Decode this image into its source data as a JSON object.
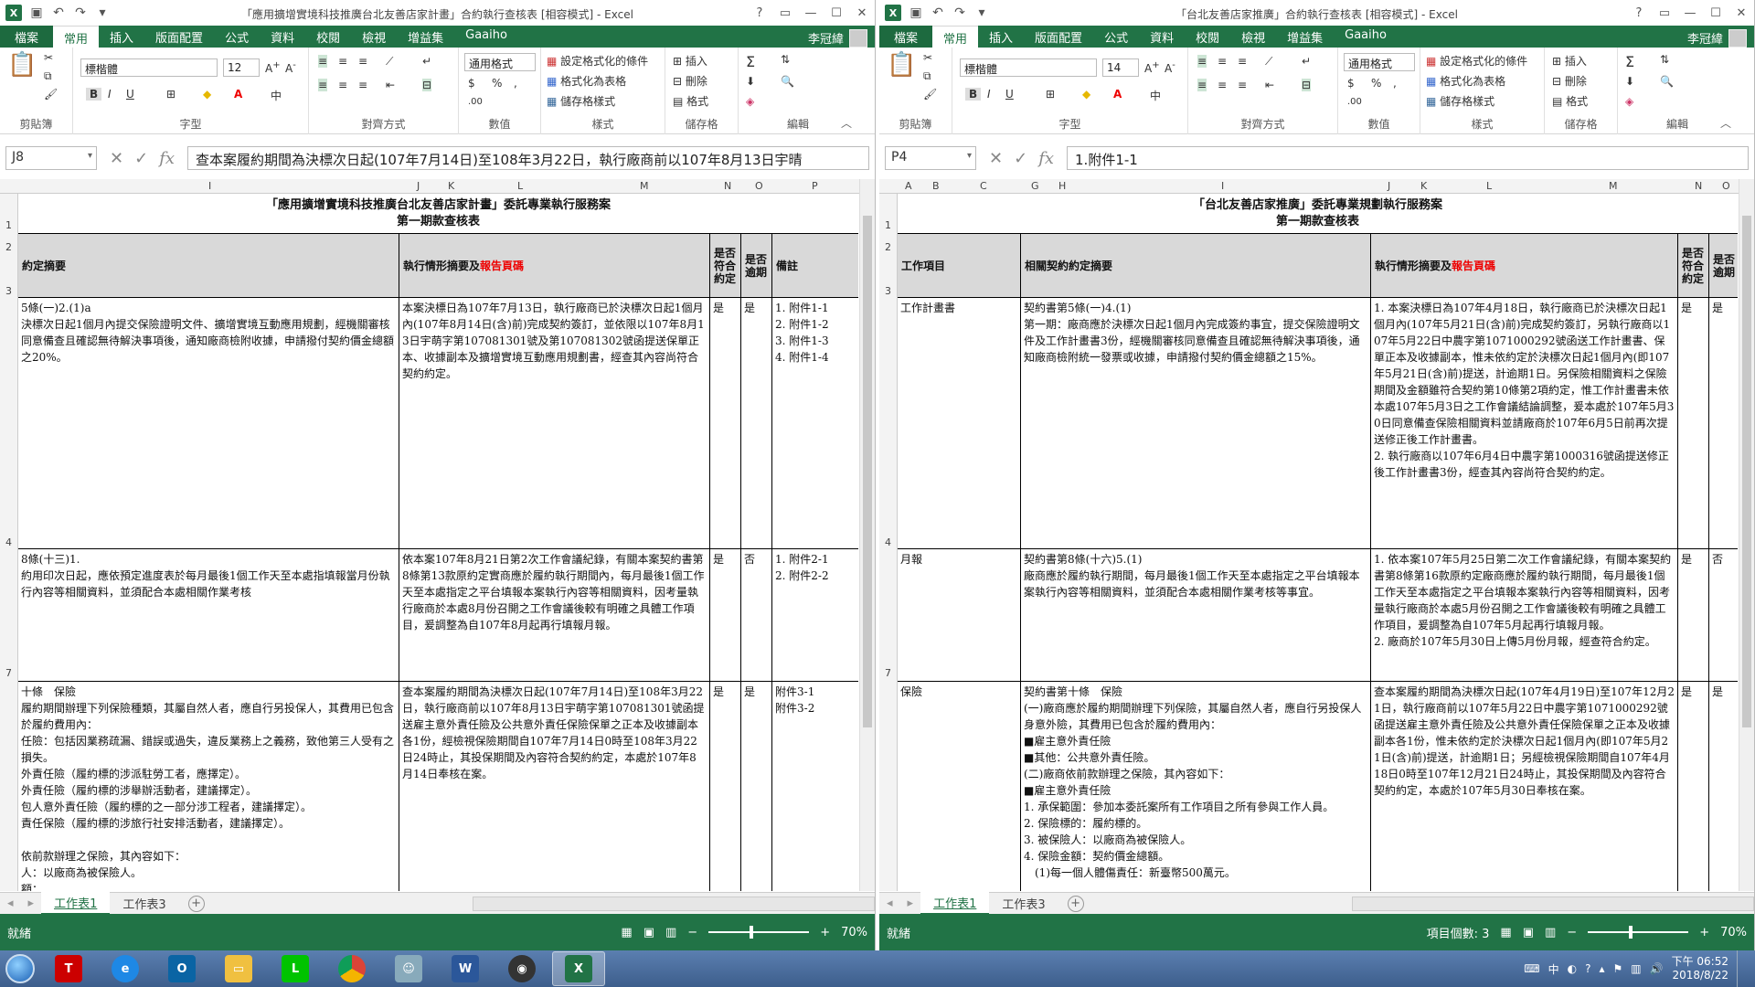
{
  "left": {
    "title": "「應用擴增實境科技推廣台北友善店家計畫」合約執行查核表 [相容模式] - Excel",
    "namebox": "J8",
    "formula": "查本案履約期間為決標次日起(107年7月14日)至108年3月22日，執行廠商前以107年8月13日宇晴",
    "col_letters": [
      "I",
      "J",
      "K",
      "L",
      "M",
      "N",
      "O",
      "P"
    ],
    "row_numbers": [
      "1",
      "2",
      "3",
      "4",
      "7"
    ],
    "sheet_title_1": "「應用擴增實境科技推廣台北友善店家計畫」委託專業執行服務案",
    "sheet_title_2": "第一期款查核表",
    "headers": {
      "c1": "約定摘要",
      "c2a": "執行情形摘要及",
      "c2b": "報告頁碼",
      "c3": "是否符合約定",
      "c4": "是否逾期",
      "c5": "備註"
    },
    "rows": [
      {
        "a": "5條(一)2.(1)a\n決標次日起1個月內提交保險證明文件、擴增實境互動應用規劃，經機關審核同意備查且確認無待解決事項後，通知廠商檢附收據，申請撥付契約價金總額之20%。",
        "b": "本案決標日為107年7月13日，執行廠商已於決標次日起1個月內(107年8月14日(含)前)完成契約簽訂，並依限以107年8月13日宇萌字第107081301號及第107081302號函提送保單正本、收據副本及擴增實境互動應用規劃書，經查其內容尚符合契約約定。",
        "c": "是",
        "d": "是",
        "e": "1. 附件1-1\n2. 附件1-2\n3. 附件1-3\n4. 附件1-4"
      },
      {
        "a": "8條(十三)1.\n約用印次日起，應依預定進度表於每月最後1個工作天至本處指填報當月份執行內容等相關資料，並須配合本處相關作業考核",
        "b": "依本案107年8月21日第2次工作會議紀錄，有關本案契約書第8條第13款原約定實商應於履約執行期間內，每月最後1個工作天至本處指定之平台填報本案執行內容等相關資料，因考量執行廠商於本處8月份召開之工作會議後較有明確之具體工作項目，爰調整為自107年8月起再行填報月報。",
        "c": "是",
        "d": "否",
        "e": "1. 附件2-1\n2. 附件2-2"
      },
      {
        "a": "十條　保險\n履約期間辦理下列保險種類，其屬自然人者，應自行另投保人，其費用已包含於履約費用內：\n任險：包括因業務疏漏、錯誤或過失，違反業務上之義務，致他第三人受有之損失。\n外責任險（履約標的涉派駐勞工者，應擇定）。\n外責任險（履約標的涉舉辦活動者，建議擇定）。\n包人意外責任險（履約標的之一部分涉工程者，建議擇定）。\n責任保險（履約標的涉旅行社安排活動者，建議擇定）。\n\n依前款辦理之保險，其內容如下：\n人：以廠商為被保險人。\n額：",
        "b": "查本案履約期間為決標次日起(107年7月14日)至108年3月22日，執行廠商前以107年8月13日宇萌字第107081301號函提送雇主意外責任險及公共意外責任保險保單之正本及收據副本各1份，經檢視保險期間自107年7月14日0時至108年3月22日24時止，其投保期間及內容符合契約約定，本處於107年8月14日奉核在案。",
        "c": "是",
        "d": "是",
        "e": "附件3-1\n附件3-2"
      }
    ]
  },
  "right": {
    "title": "「台北友善店家推廣」合約執行查核表 [相容模式] - Excel",
    "namebox": "P4",
    "formula": "1.附件1-1",
    "col_letters": [
      "A",
      "B",
      "C",
      "G",
      "H",
      "I",
      "J",
      "K",
      "L",
      "M",
      "N",
      "O"
    ],
    "row_numbers": [
      "1",
      "2",
      "3",
      "4",
      "7"
    ],
    "sheet_title_1": "「台北友善店家推廣」委託專業規劃執行服務案",
    "sheet_title_2": "第一期款查核表",
    "headers": {
      "c1": "工作項目",
      "c2": "相關契約約定摘要",
      "c3a": "執行情形摘要及",
      "c3b": "報告頁碼",
      "c4": "是否符合約定",
      "c5": "是否逾期"
    },
    "rows": [
      {
        "a": "工作計畫書",
        "b": "契約書第5條(一)4.(1)\n第一期：廠商應於決標次日起1個月內完成簽約事宜，提交保險證明文件及工作計畫書3份，經機關審核同意備查且確認無待解決事項後，通知廠商檢附統一發票或收據，申請撥付契約價金總額之15%。",
        "c": "1. 本案決標日為107年4月18日，執行廠商已於決標次日起1個月內(107年5月21日(含)前)完成契約簽訂，另執行廠商以107年5月22日中農字第1071000292號函送工作計畫書、保單正本及收據副本，惟未依約定於決標次日起1個月內(即107年5月21日(含)前)提送，計逾期1日。另保險相關資料之保險期間及金額雖符合契約第10條第2項約定，惟工作計畫書未依本處107年5月3日之工作會議結論調整，爰本處於107年5月30日同意備查保險相關資料並請廠商於107年6月5日前再次提送修正後工作計畫書。\n2. 執行廠商以107年6月4日中農字第1000316號函提送修正後工作計畫書3份，經查其內容尚符合契約約定。",
        "d": "是",
        "e": "是"
      },
      {
        "a": "月報",
        "b": "契約書第8條(十六)5.(1)\n廠商應於履約執行期間，每月最後1個工作天至本處指定之平台填報本案執行內容等相關資料，並須配合本處相關作業考核等事宜。",
        "c": "1. 依本案107年5月25日第二次工作會議紀錄，有關本案契約書第8條第16款原約定廠商應於履約執行期間，每月最後1個工作天至本處指定之平台填報本案執行內容等相關資料，因考量執行廠商於本處5月份召開之工作會議後較有明確之具體工作項目，爰調整為自107年5月起再行填報月報。\n2. 廠商於107年5月30日上傳5月份月報，經查符合約定。",
        "d": "是",
        "e": "否"
      },
      {
        "a": "保險",
        "b": "契約書第十條　保險\n(一)廠商應於履約期間辦理下列保險，其屬自然人者，應自行另投保人身意外險，其費用已包含於履約費用內：\n■雇主意外責任險\n■其他：公共意外責任險。\n(二)廠商依前款辦理之保險，其內容如下：\n■雇主意外責任險\n1. 承保範圍：參加本委託案所有工作項目之所有參與工作人員。\n2. 保險標的：履約標的。\n3. 被保險人：以廠商為被保險人。\n4. 保險金額：契約價金總額。\n　(1)每一個人體傷責任：新臺幣500萬元。",
        "c": "查本案履約期間為決標次日起(107年4月19日)至107年12月21日，執行廠商前以107年5月22日中農字第1071000292號函提送雇主意外責任險及公共意外責任保險保單之正本及收據副本各1份，惟未依約定於決標次日起1個月內(即107年5月21日(含)前)提送，計逾期1日；另經檢視保險期間自107年4月18日0時至107年12月21日24時止，其投保期間及內容符合契約約定，本處於107年5月30日奉核在案。",
        "d": "是",
        "e": "是"
      }
    ]
  },
  "ribbon": {
    "tabs": [
      "檔案",
      "常用",
      "插入",
      "版面配置",
      "公式",
      "資料",
      "校閱",
      "檢視",
      "增益集",
      "Gaaiho"
    ],
    "user": "李冠緯",
    "font_name": "標楷體",
    "font_size_left": "12",
    "font_size_right": "14",
    "number_format": "通用格式",
    "groups": [
      "剪貼簿",
      "字型",
      "對齊方式",
      "數值",
      "樣式",
      "儲存格",
      "編輯"
    ],
    "style_items": [
      "設定格式化的條件",
      "格式化為表格",
      "儲存格樣式"
    ],
    "cell_items": [
      "插入",
      "刪除",
      "格式"
    ],
    "bold": "B",
    "italic": "I",
    "underline": "U",
    "percent": "%",
    "currency": "$"
  },
  "sheets": [
    "工作表1",
    "工作表3"
  ],
  "status": {
    "ready": "就緒",
    "zoom": "70%",
    "right_count": "項目個數: 3"
  },
  "taskbar": {
    "time": "下午 06:52",
    "date": "2018/8/22",
    "ime": "中"
  }
}
